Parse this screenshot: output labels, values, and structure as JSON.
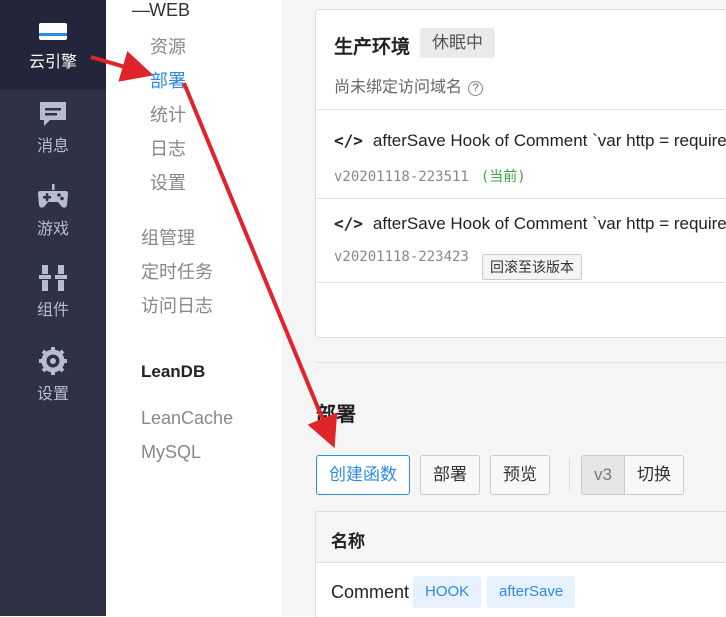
{
  "rail": {
    "items": [
      {
        "label": "云引擎",
        "icon": "cloud-engine-icon"
      },
      {
        "label": "消息",
        "icon": "message-icon"
      },
      {
        "label": "游戏",
        "icon": "gamepad-icon"
      },
      {
        "label": "组件",
        "icon": "component-icon"
      },
      {
        "label": "设置",
        "icon": "gear-icon"
      }
    ]
  },
  "nav": {
    "web_header": "WEB",
    "web_collapse": "—",
    "web_items": [
      "资源",
      "部署",
      "统计",
      "日志",
      "设置"
    ],
    "items": [
      "组管理",
      "定时任务",
      "访问日志"
    ],
    "leandb_header": "LeanDB",
    "leandb_items": [
      "LeanCache",
      "MySQL"
    ]
  },
  "env": {
    "title": "生产环境",
    "status": "休眠中",
    "subtitle": "尚未绑定访问域名",
    "help_icon": "?"
  },
  "versions": [
    {
      "code_icon": "</>",
      "title": "afterSave Hook of Comment `var http = require",
      "id": "v20201118-223511",
      "current_label": "(当前)"
    },
    {
      "code_icon": "</>",
      "title": "afterSave Hook of Comment `var http = require",
      "id": "v20201118-223423",
      "rollback_label": "回滚至该版本"
    }
  ],
  "deploy": {
    "title": "部署",
    "create_label": "创建函数",
    "deploy_label": "部署",
    "preview_label": "预览",
    "version_label": "v3",
    "switch_label": "切换"
  },
  "table": {
    "header": "名称",
    "rows": [
      {
        "name": "Comment",
        "tags": [
          "HOOK",
          "afterSave"
        ]
      }
    ]
  },
  "colors": {
    "rail_bg": "#2f3245",
    "rail_active": "#23253a",
    "accent": "#2f8ae5",
    "annotation_arrow": "#e0242b",
    "current_green": "#3aa63a"
  }
}
